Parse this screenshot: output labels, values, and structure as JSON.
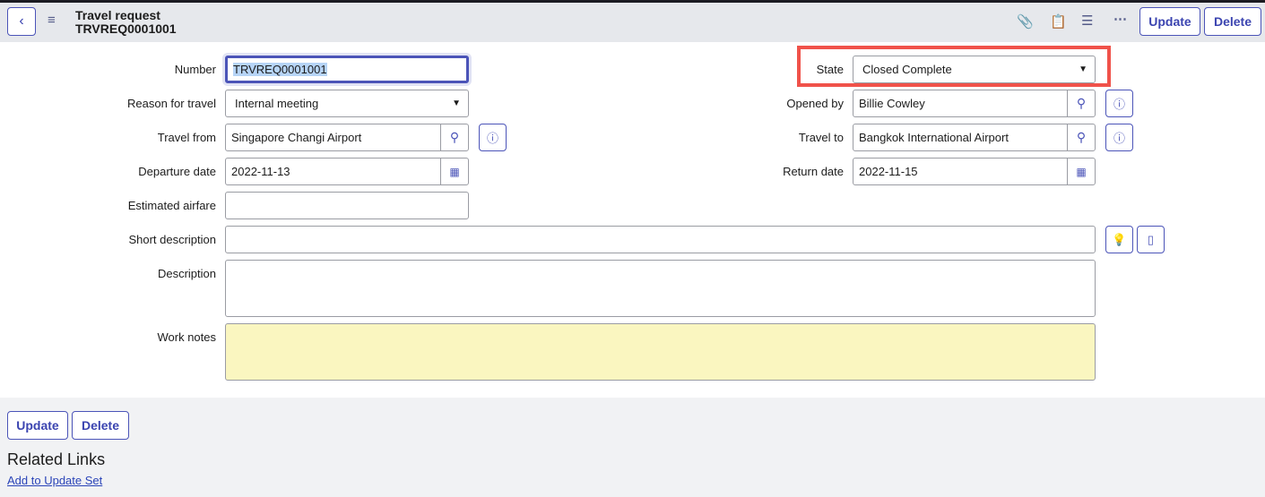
{
  "header": {
    "title": "Travel request",
    "record": "TRVREQ0001001",
    "update": "Update",
    "delete": "Delete"
  },
  "form": {
    "number": {
      "label": "Number",
      "value": "TRVREQ0001001"
    },
    "reason": {
      "label": "Reason for travel",
      "value": "Internal meeting"
    },
    "travel_from": {
      "label": "Travel from",
      "value": "Singapore Changi Airport"
    },
    "departure": {
      "label": "Departure date",
      "value": "2022-11-13"
    },
    "airfare": {
      "label": "Estimated airfare",
      "value": ""
    },
    "short_desc": {
      "label": "Short description",
      "value": ""
    },
    "description": {
      "label": "Description",
      "value": ""
    },
    "work_notes": {
      "label": "Work notes",
      "value": ""
    },
    "state": {
      "label": "State",
      "value": "Closed Complete"
    },
    "opened_by": {
      "label": "Opened by",
      "value": "Billie Cowley"
    },
    "travel_to": {
      "label": "Travel to",
      "value": "Bangkok International Airport"
    },
    "return": {
      "label": "Return date",
      "value": "2022-11-15"
    }
  },
  "footer": {
    "update": "Update",
    "delete": "Delete",
    "related_links": "Related Links",
    "add_to_update_set": "Add to Update Set"
  },
  "colors": {
    "accent": "#4b54b8",
    "highlight": "#f0524a",
    "work_notes_bg": "#faf6c0"
  }
}
